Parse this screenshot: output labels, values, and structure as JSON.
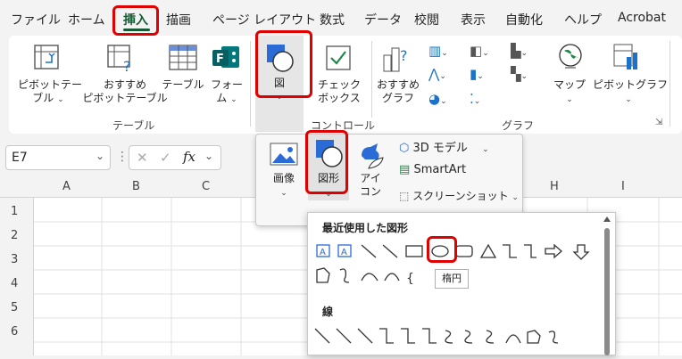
{
  "menu": {
    "tabs": [
      "ファイル",
      "ホーム",
      "挿入",
      "描画",
      "ページ レイアウト",
      "数式",
      "データ",
      "校閲",
      "表示",
      "自動化",
      "ヘルプ",
      "Acrobat"
    ],
    "active": "挿入"
  },
  "ribbon": {
    "pivot_table": [
      "ピボットテー",
      "ブル"
    ],
    "recommended_pivot": [
      "おすすめ",
      "ピボットテーブル"
    ],
    "table": "テーブル",
    "forms": [
      "フォー",
      "ム"
    ],
    "illustrations": "図",
    "checkbox": [
      "チェック",
      "ボックス"
    ],
    "recommended_chart": [
      "おすすめ",
      "グラフ"
    ],
    "map": "マップ",
    "pivot_chart": "ピボットグラフ",
    "group_table": "テーブル",
    "group_control": "コントロール",
    "group_chart": "グラフ"
  },
  "namebox": {
    "value": "E7"
  },
  "columns": [
    "A",
    "B",
    "C",
    "H",
    "I"
  ],
  "rows": [
    "1",
    "2",
    "3",
    "4",
    "5",
    "6"
  ],
  "panel": {
    "image": "画像",
    "shapes": "図形",
    "icons": [
      "アイ",
      "コン"
    ],
    "model3d": "3D モデル",
    "smartart": "SmartArt",
    "screenshot": "スクリーンショット"
  },
  "shapes_gallery": {
    "recent_title": "最近使用した図形",
    "lines_title": "線",
    "tooltip": "楕円"
  },
  "colors": {
    "accent": "#185c37",
    "highlight": "#e00000"
  }
}
